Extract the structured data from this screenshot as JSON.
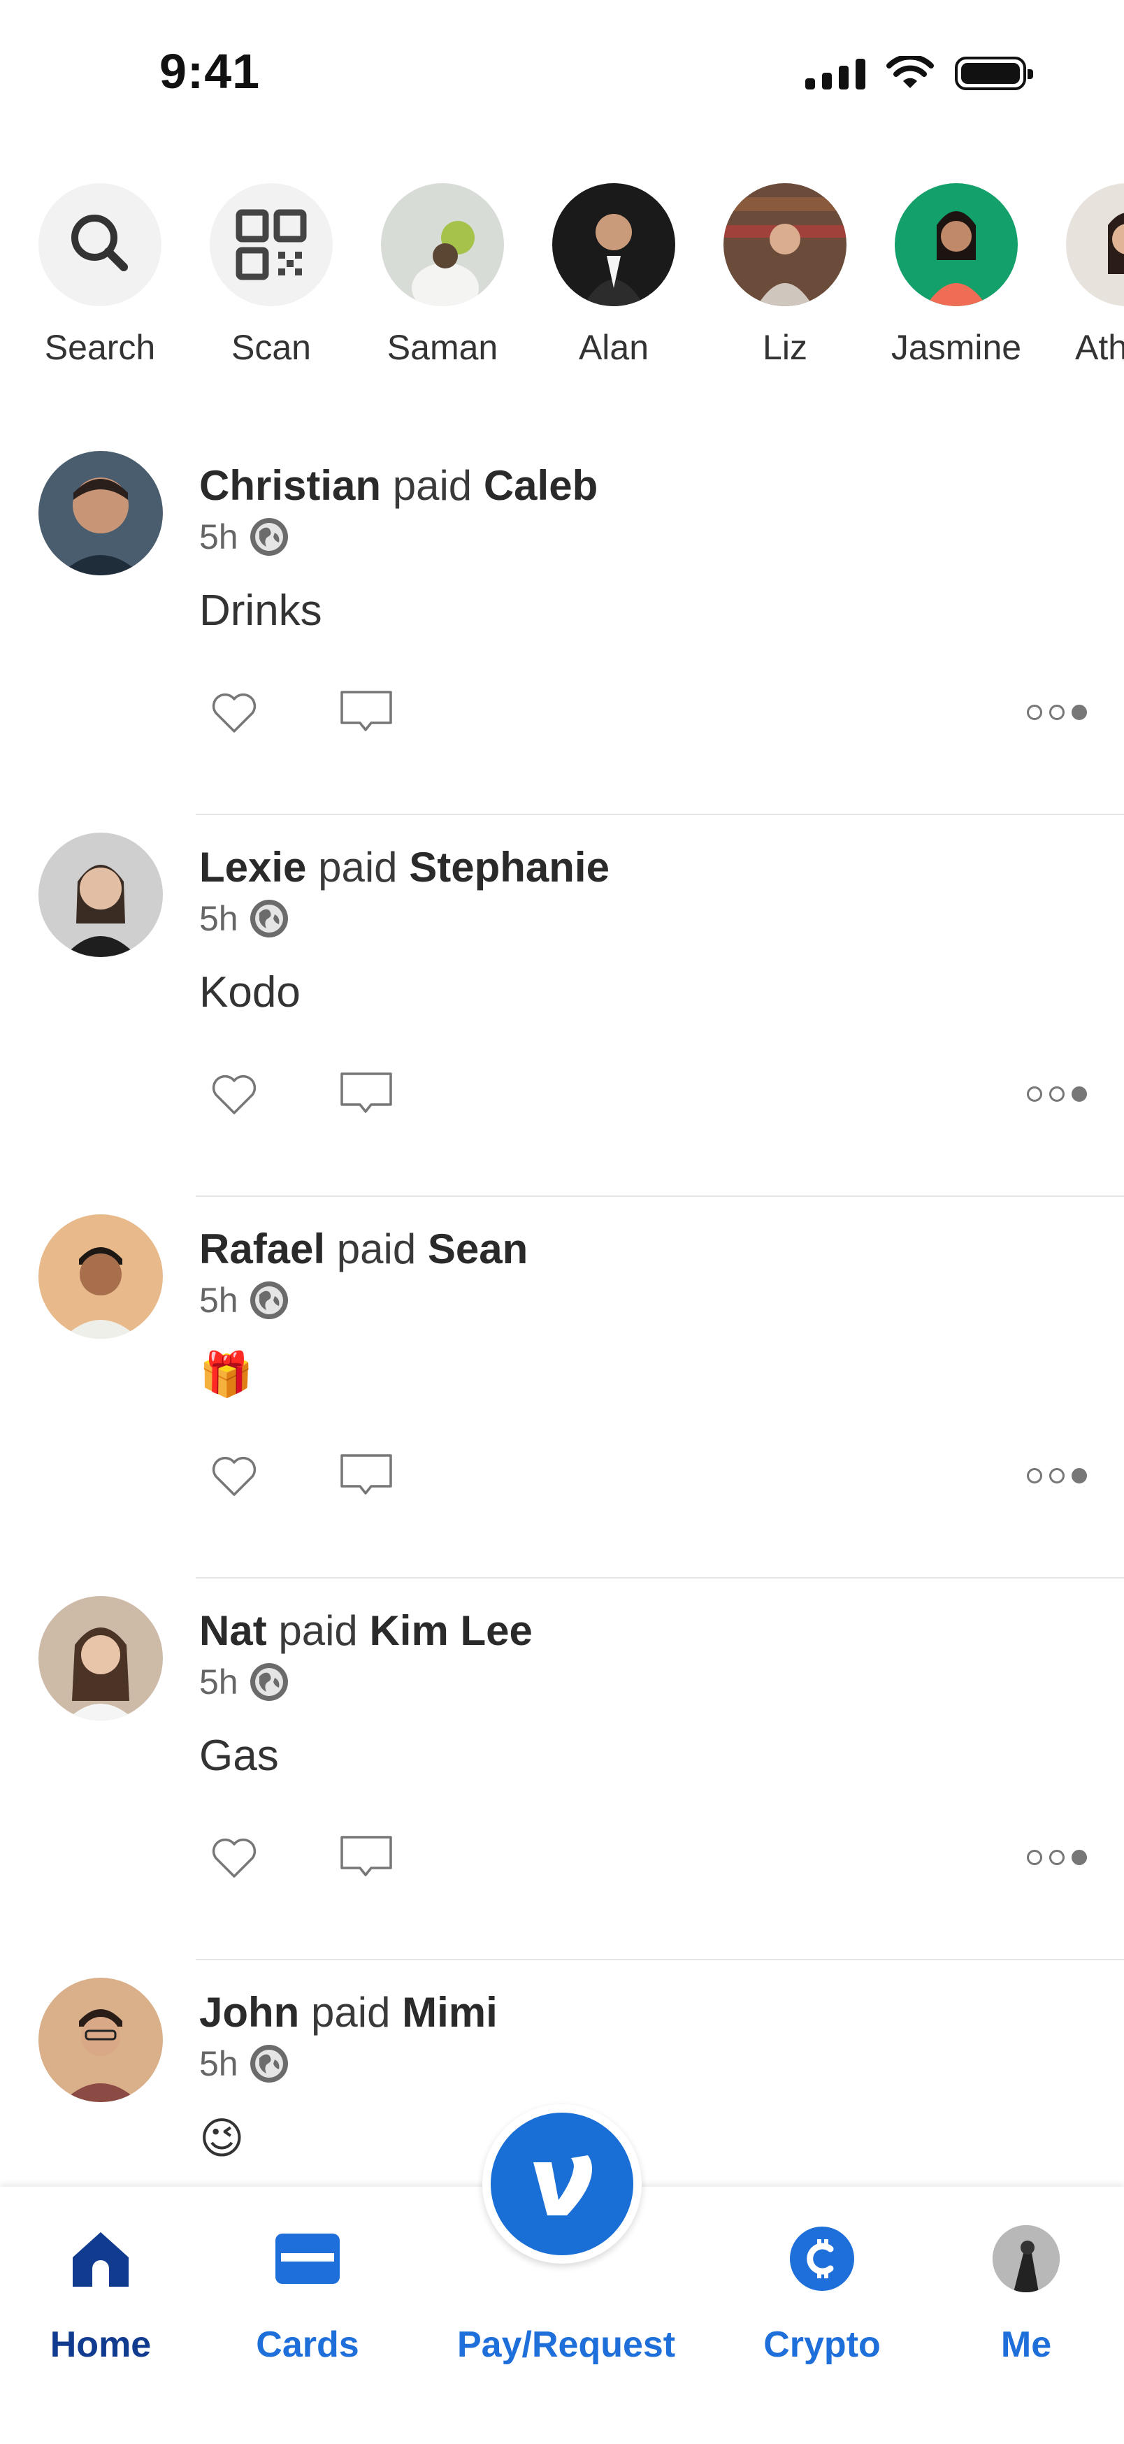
{
  "status_bar": {
    "time": "9:41"
  },
  "stories": [
    {
      "label": "Search",
      "icon": "search-icon"
    },
    {
      "label": "Scan",
      "icon": "qr-code-icon"
    },
    {
      "label": "Saman",
      "avatar_color": "#d8dcd6"
    },
    {
      "label": "Alan",
      "avatar_color": "#1a1a1a"
    },
    {
      "label": "Liz",
      "avatar_color": "#6b4b3a"
    },
    {
      "label": "Jasmine",
      "avatar_color": "#14a06a"
    },
    {
      "label": "Ath",
      "avatar_color": "#e8e2dc"
    }
  ],
  "feed": [
    {
      "payer": "Christian",
      "verb": "paid",
      "payee": "Caleb",
      "time": "5h",
      "note": "Drinks",
      "avatar_color": "#4a5d6e"
    },
    {
      "payer": "Lexie",
      "verb": "paid",
      "payee": "Stephanie",
      "time": "5h",
      "note": "Kodo",
      "avatar_color": "#cfcfcf"
    },
    {
      "payer": "Rafael",
      "verb": "paid",
      "payee": "Sean",
      "time": "5h",
      "note": "🎁",
      "avatar_color": "#e8b98a"
    },
    {
      "payer": "Nat",
      "verb": "paid",
      "payee": "Kim Lee",
      "time": "5h",
      "note": "Gas",
      "avatar_color": "#cdbba8"
    },
    {
      "payer": "John",
      "verb": "paid",
      "payee": "Mimi",
      "time": "5h",
      "note": "😉",
      "avatar_color": "#d9b08a"
    }
  ],
  "tab_bar": {
    "home": "Home",
    "cards": "Cards",
    "pay_request": "Pay/Request",
    "crypto": "Crypto",
    "me": "Me"
  },
  "colors": {
    "accent": "#1a6fd6",
    "active_tab": "#113b8f"
  }
}
